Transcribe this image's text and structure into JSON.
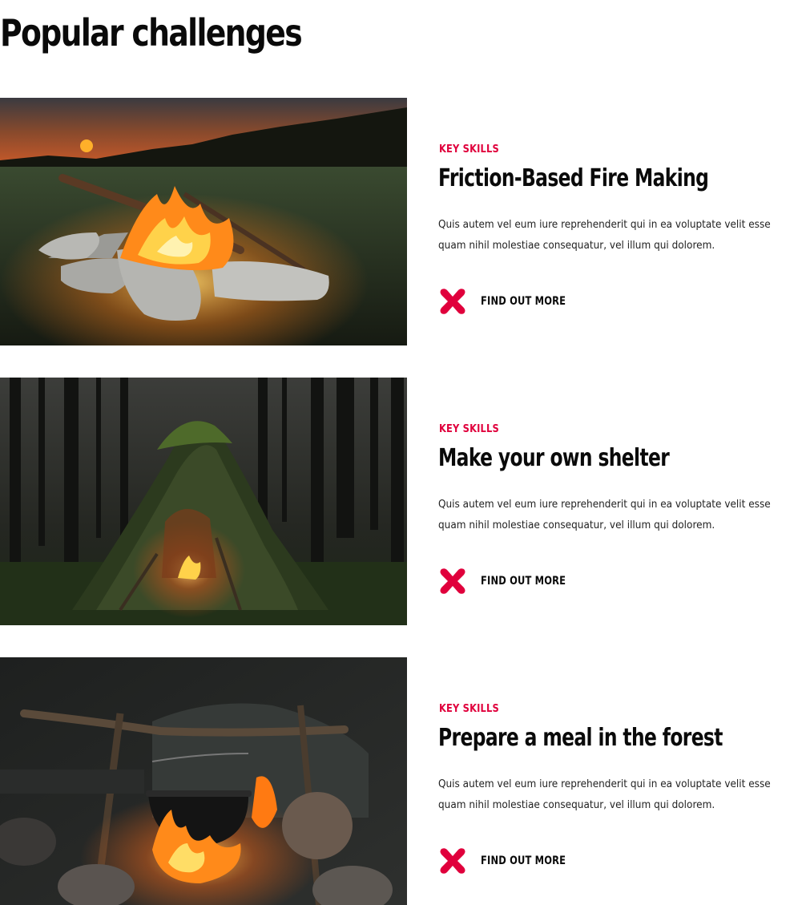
{
  "section": {
    "title": "Popular challenges"
  },
  "theme": {
    "accent": "#e0003c",
    "text": "#0a0a0a"
  },
  "challenges": [
    {
      "kicker": "KEY SKILLS",
      "title": "Friction-Based Fire Making",
      "excerpt": "Quis autem vel eum iure reprehenderit qui in ea voluptate velit esse quam nihil molestiae consequatur, vel illum qui dolorem.",
      "cta_label": "FIND OUT MORE",
      "cta_icon": "x-mark-icon"
    },
    {
      "kicker": "KEY SKILLS",
      "title": "Make your own shelter",
      "excerpt": "Quis autem vel eum iure reprehenderit qui in ea voluptate velit esse quam nihil molestiae consequatur, vel illum qui dolorem.",
      "cta_label": "FIND OUT MORE",
      "cta_icon": "x-mark-icon"
    },
    {
      "kicker": "KEY SKILLS",
      "title": "Prepare a meal in the forest",
      "excerpt": "Quis autem vel eum iure reprehenderit qui in ea voluptate velit esse quam nihil molestiae consequatur, vel illum qui dolorem.",
      "cta_label": "FIND OUT MORE",
      "cta_icon": "x-mark-icon"
    }
  ]
}
